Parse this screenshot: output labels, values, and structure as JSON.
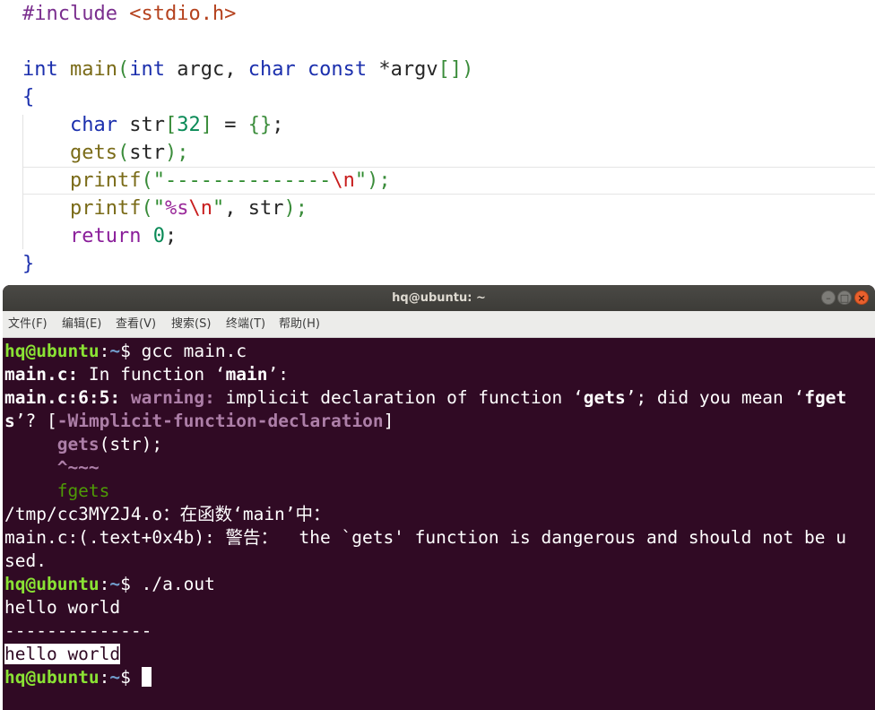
{
  "editor": {
    "line1": {
      "pre": "#include",
      "sp": " ",
      "inc": "<stdio.h>"
    },
    "line3": {
      "kw1": "int",
      "sp1": " ",
      "fn": "main",
      "p1": "(",
      "kw2": "int",
      "args1": " argc, ",
      "kw3": "char",
      "sp2": " ",
      "kw4": "const",
      "args2": " *argv",
      "br": "[]",
      "p2": ")"
    },
    "line4": {
      "brace": "{"
    },
    "line5": {
      "indent": "    ",
      "kw": "char",
      "decl": " str",
      "lb": "[",
      "num": "32",
      "rb": "]",
      "eq": " = ",
      "init": "{}",
      "end": ";"
    },
    "line6": {
      "indent": "    ",
      "fn": "gets",
      "p1": "(",
      "arg": "str",
      "p2": ");"
    },
    "line7": {
      "indent": "    ",
      "fn": "printf",
      "p1": "(",
      "str": "\"--------------",
      "esc": "\\n",
      "strq": "\"",
      "p2": ");"
    },
    "line8": {
      "indent": "    ",
      "fn": "printf",
      "p1": "(",
      "str1": "\"",
      "fmt": "%s",
      "esc": "\\n",
      "str2": "\"",
      "rest": ", str",
      "p2": ");"
    },
    "line9": {
      "indent": "    ",
      "kw": "return",
      "sp": " ",
      "num": "0",
      "end": ";"
    },
    "line10": {
      "brace": "}"
    }
  },
  "terminal": {
    "title": "hq@ubuntu: ~",
    "menu": [
      "文件(F)",
      "编辑(E)",
      "查看(V)",
      "搜索(S)",
      "终端(T)",
      "帮助(H)"
    ],
    "user": "hq@ubuntu",
    "colon": ":",
    "path": "~",
    "dollar": "$ ",
    "cmd1": "gcc main.c",
    "out1": {
      "file": "main.c:",
      "rest1": " In function ‘",
      "fn": "main",
      "rest2": "’:"
    },
    "out2": {
      "loc": "main.c:6:5:",
      "sp": " ",
      "warn": "warning:",
      "msg1": " implicit declaration of function ‘",
      "fn1": "gets",
      "msg2": "’; did you mean ‘",
      "fn2": "fget"
    },
    "out3": {
      "fn": "s",
      "msg": "’? [",
      "flag": "-Wimplicit-function-declaration",
      "end": "]"
    },
    "out4": {
      "indent": "     ",
      "fn": "gets",
      "rest": "(str);"
    },
    "out5": {
      "indent": "     ",
      "caret": "^~~~"
    },
    "out6": {
      "indent": "     ",
      "sugg": "fgets"
    },
    "out7": "/tmp/cc3MY2J4.o：在函数‘main’中：",
    "out8": "main.c:(.text+0x4b): 警告：  the `gets' function is dangerous and should not be u",
    "out9": "sed.",
    "cmd2": "./a.out",
    "out10": "hello world",
    "out11": "--------------",
    "out12": "hello world"
  }
}
